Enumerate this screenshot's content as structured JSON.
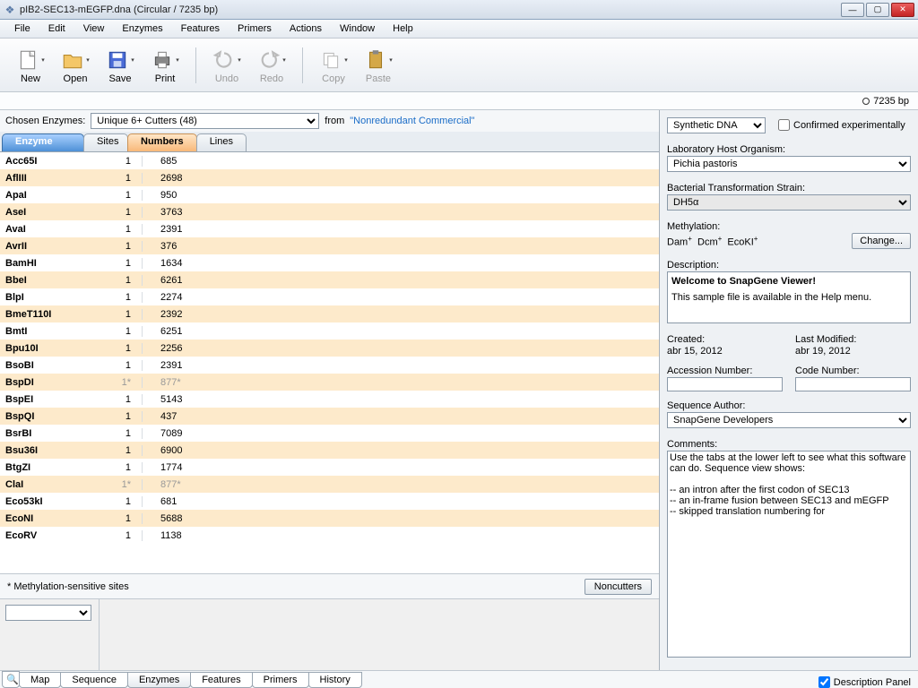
{
  "title": "pIB2-SEC13-mEGFP.dna  (Circular / 7235 bp)",
  "menubar": [
    "File",
    "Edit",
    "View",
    "Enzymes",
    "Features",
    "Primers",
    "Actions",
    "Window",
    "Help"
  ],
  "toolbar": [
    {
      "name": "new",
      "label": "New"
    },
    {
      "name": "open",
      "label": "Open"
    },
    {
      "name": "save",
      "label": "Save"
    },
    {
      "name": "print",
      "label": "Print"
    },
    {
      "name": "sep"
    },
    {
      "name": "undo",
      "label": "Undo",
      "disabled": true
    },
    {
      "name": "redo",
      "label": "Redo",
      "disabled": true
    },
    {
      "name": "sep"
    },
    {
      "name": "copy",
      "label": "Copy",
      "disabled": true
    },
    {
      "name": "paste",
      "label": "Paste",
      "disabled": true
    }
  ],
  "size_status": "7235 bp",
  "chooser": {
    "label": "Chosen Enzymes:",
    "value": "Unique 6+ Cutters  (48)",
    "from_lbl": "from",
    "from_src": "\"Nonredundant Commercial\""
  },
  "header_tabs": {
    "enzyme": "Enzyme",
    "sites": "Sites",
    "numbers": "Numbers",
    "lines": "Lines"
  },
  "rows": [
    {
      "enz": "Acc65I",
      "sites": "1",
      "num": "685"
    },
    {
      "enz": "AflIII",
      "sites": "1",
      "num": "2698"
    },
    {
      "enz": "ApaI",
      "sites": "1",
      "num": "950"
    },
    {
      "enz": "AseI",
      "sites": "1",
      "num": "3763"
    },
    {
      "enz": "AvaI",
      "sites": "1",
      "num": "2391"
    },
    {
      "enz": "AvrII",
      "sites": "1",
      "num": "376"
    },
    {
      "enz": "BamHI",
      "sites": "1",
      "num": "1634"
    },
    {
      "enz": "BbeI",
      "sites": "1",
      "num": "6261"
    },
    {
      "enz": "BlpI",
      "sites": "1",
      "num": "2274"
    },
    {
      "enz": "BmeT110I",
      "sites": "1",
      "num": "2392"
    },
    {
      "enz": "BmtI",
      "sites": "1",
      "num": "6251"
    },
    {
      "enz": "Bpu10I",
      "sites": "1",
      "num": "2256"
    },
    {
      "enz": "BsoBI",
      "sites": "1",
      "num": "2391"
    },
    {
      "enz": "BspDI",
      "sites": "1*",
      "num": "877*",
      "meth": true
    },
    {
      "enz": "BspEI",
      "sites": "1",
      "num": "5143"
    },
    {
      "enz": "BspQI",
      "sites": "1",
      "num": "437"
    },
    {
      "enz": "BsrBI",
      "sites": "1",
      "num": "7089"
    },
    {
      "enz": "Bsu36I",
      "sites": "1",
      "num": "6900"
    },
    {
      "enz": "BtgZI",
      "sites": "1",
      "num": "1774"
    },
    {
      "enz": "ClaI",
      "sites": "1*",
      "num": "877*",
      "meth": true
    },
    {
      "enz": "Eco53kI",
      "sites": "1",
      "num": "681"
    },
    {
      "enz": "EcoNI",
      "sites": "1",
      "num": "5688"
    },
    {
      "enz": "EcoRV",
      "sites": "1",
      "num": "1138"
    }
  ],
  "footer": {
    "note": "* Methylation-sensitive sites",
    "noncutters": "Noncutters"
  },
  "bottom_tabs": [
    "Map",
    "Sequence",
    "Enzymes",
    "Features",
    "Primers",
    "History"
  ],
  "bottom_search_icon": "🔍",
  "desc_panel_label": "Description Panel",
  "right": {
    "synthetic": "Synthetic DNA",
    "confirmed": "Confirmed experimentally",
    "lab_host_label": "Laboratory Host Organism:",
    "lab_host": "Pichia pastoris",
    "strain_label": "Bacterial Transformation Strain:",
    "strain": "DH5α",
    "meth_label": "Methylation:",
    "meth_value": "Dam⁺  Dcm⁺  EcoKI⁺",
    "change": "Change...",
    "desc_label": "Description:",
    "desc_title": "Welcome to SnapGene Viewer!",
    "desc_body": "This sample file is available in the Help menu.",
    "created_label": "Created:",
    "created": "abr 15, 2012",
    "modified_label": "Last Modified:",
    "modified": "abr 19, 2012",
    "accession_label": "Accession Number:",
    "code_label": "Code Number:",
    "author_label": "Sequence Author:",
    "author": "SnapGene Developers",
    "comments_label": "Comments:",
    "comments": "Use the tabs at the lower left to see what this software can do. Sequence view shows:\n\n-- an intron after the first codon of SEC13\n-- an in-frame fusion between SEC13 and mEGFP\n-- skipped translation numbering for"
  }
}
